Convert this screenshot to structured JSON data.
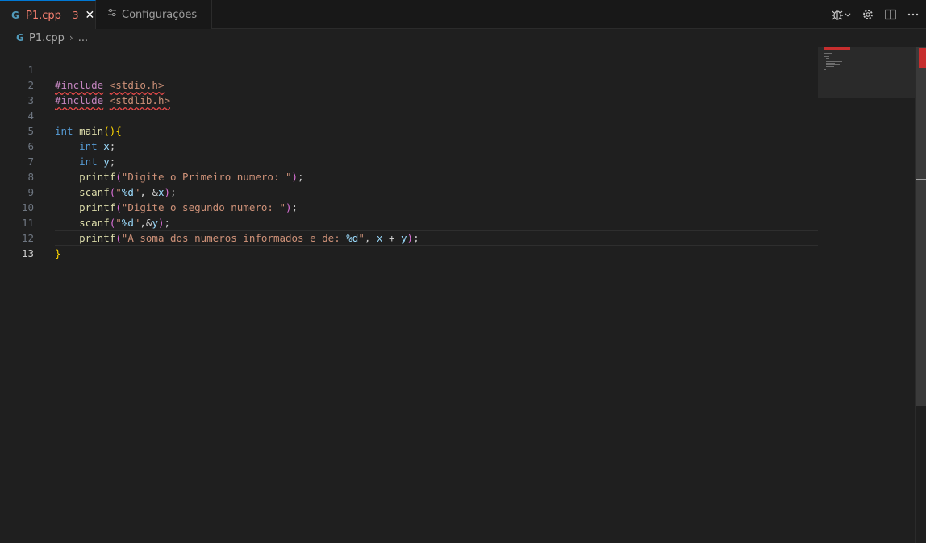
{
  "tabs": [
    {
      "icon": "C++",
      "label": "P1.cpp",
      "problems": "3",
      "close": "✕"
    },
    {
      "icon": "settings-icon",
      "label": "Configurações"
    }
  ],
  "breadcrumb": {
    "icon": "C++",
    "file": "P1.cpp",
    "sep": "›",
    "more": "..."
  },
  "line_numbers": [
    "1",
    "2",
    "3",
    "4",
    "5",
    "6",
    "7",
    "8",
    "9",
    "10",
    "11",
    "12",
    "13"
  ],
  "code": {
    "l1": {
      "directive": "#include",
      "header": "<stdio.h>"
    },
    "l2": {
      "directive": "#include",
      "header": "<stdlib.h>"
    },
    "l4": {
      "type": "int",
      "name": "main",
      "parens": "()",
      "brace": "{"
    },
    "l5": {
      "type": "int",
      "var": "x",
      "end": ";"
    },
    "l6": {
      "type": "int",
      "var": "y",
      "end": ";"
    },
    "l7": {
      "fn": "printf",
      "open": "(",
      "str": "\"Digite o Primeiro numero: \"",
      "close": ")",
      "end": ";"
    },
    "l8": {
      "fn": "scanf",
      "open": "(",
      "q1": "\"",
      "fmt": "%d",
      "q2": "\"",
      "rest": ", &",
      "var": "x",
      "close": ")",
      "end": ";"
    },
    "l9": {
      "fn": "printf",
      "open": "(",
      "str": "\"Digite o segundo numero: \"",
      "close": ")",
      "end": ";"
    },
    "l10": {
      "fn": "scanf",
      "open": "(",
      "q1": "\"",
      "fmt": "%d",
      "q2": "\"",
      "rest": ",&",
      "var": "y",
      "close": ")",
      "end": ";"
    },
    "l11": {
      "fn": "printf",
      "open": "(",
      "str": "\"A soma dos numeros informados e de: ",
      "fmt": "%d",
      "q2": "\"",
      "comma": ", ",
      "var1": "x",
      "plus": " + ",
      "var2": "y",
      "close": ")",
      "end": ";"
    },
    "l12": {
      "brace": "}"
    }
  },
  "colors": {
    "accent": "#0078d4",
    "error": "#f14c4c",
    "tab_error_label": "#f88070"
  }
}
